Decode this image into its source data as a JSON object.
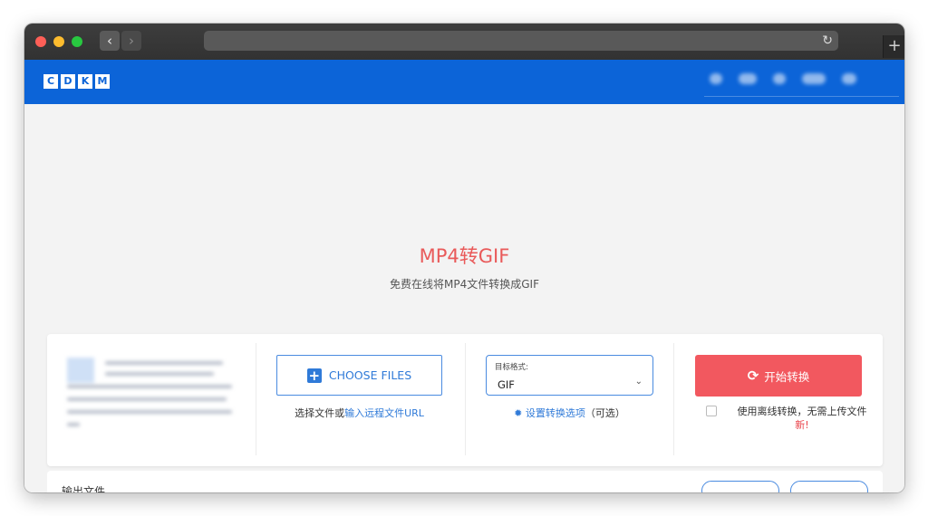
{
  "browser": {
    "back_glyph": "‹",
    "forward_glyph": "›",
    "reload_glyph": "↻",
    "newtab_glyph": "+"
  },
  "site": {
    "logo_letters": [
      "C",
      "D",
      "K",
      "M"
    ],
    "brand_color": "#0c64d8"
  },
  "page": {
    "title": "MP4转GIF",
    "subtitle": "免费在线将MP4文件转换成GIF"
  },
  "upload": {
    "choose_label": "CHOOSE FILES",
    "hint_prefix": "选择文件或",
    "hint_link": "输入远程文件URL"
  },
  "format": {
    "label": "目标格式:",
    "value": "GIF",
    "options_link": "设置转换选项",
    "options_suffix": "（可选）"
  },
  "convert": {
    "start_label": "开始转换",
    "offline_text": "使用离线转换，无需上传文件",
    "new_badge": "新!",
    "accent_color": "#f2585f"
  },
  "output": {
    "title": "输出文件"
  }
}
